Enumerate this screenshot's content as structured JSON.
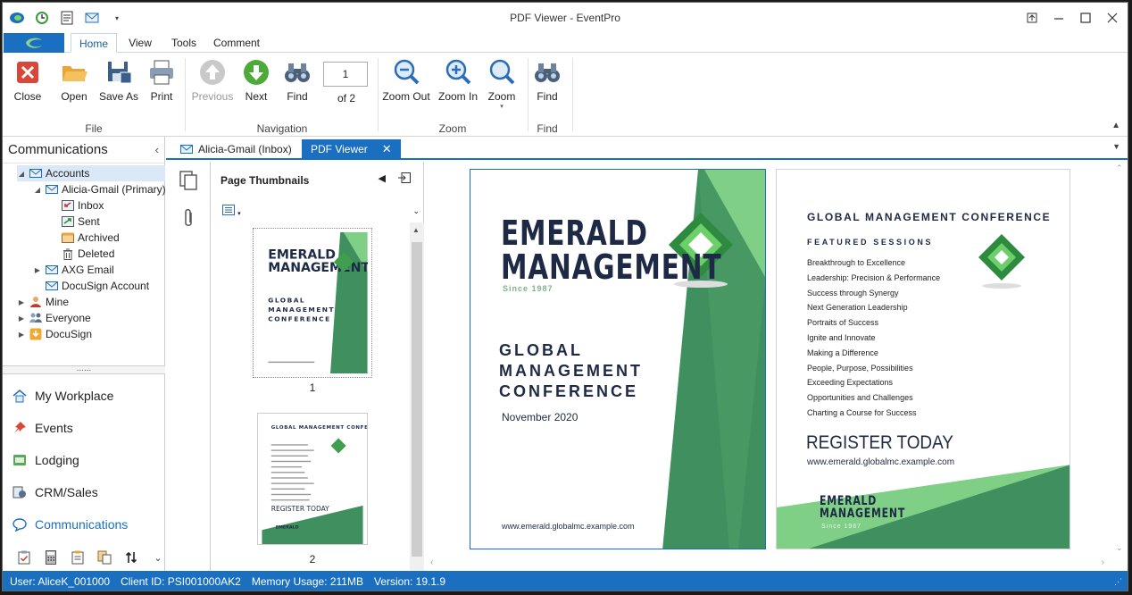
{
  "window": {
    "title": "PDF Viewer - EventPro"
  },
  "ribbon_tabs": [
    "Home",
    "View",
    "Tools",
    "Comment"
  ],
  "ribbon": {
    "file": {
      "label": "File",
      "close": "Close",
      "open": "Open",
      "save_as": "Save As",
      "print": "Print"
    },
    "navigation": {
      "label": "Navigation",
      "previous": "Previous",
      "next": "Next",
      "find": "Find",
      "page_value": "1",
      "of_pages": "of 2"
    },
    "zoom": {
      "label": "Zoom",
      "zoom_out": "Zoom Out",
      "zoom_in": "Zoom In",
      "zoom": "Zoom"
    },
    "find": {
      "label": "Find",
      "find": "Find"
    }
  },
  "leftnav": {
    "title": "Communications",
    "tree": {
      "accounts": "Accounts",
      "alicia": "Alicia-Gmail (Primary)",
      "inbox": "Inbox",
      "sent": "Sent",
      "archived": "Archived",
      "deleted": "Deleted",
      "axg": "AXG Email",
      "docusign_account": "DocuSign Account",
      "mine": "Mine",
      "everyone": "Everyone",
      "docusign": "DocuSign"
    },
    "nav": {
      "workplace": "My Workplace",
      "events": "Events",
      "lodging": "Lodging",
      "crm": "CRM/Sales",
      "communications": "Communications"
    }
  },
  "doc_tabs": {
    "inbox_tab": "Alicia-Gmail (Inbox)",
    "pdf_tab": "PDF Viewer"
  },
  "thumbnails": {
    "title": "Page Thumbnails",
    "page1": "1",
    "page2": "2"
  },
  "pdf": {
    "page1": {
      "brand_line1": "EMERALD",
      "brand_line2": "MANAGEMENT",
      "since": "Since 1987",
      "conf1": "GLOBAL",
      "conf2": "MANAGEMENT",
      "conf3": "CONFERENCE",
      "date": "November 2020",
      "url": "www.emerald.globalmc.example.com"
    },
    "page2": {
      "heading": "GLOBAL MANAGEMENT CONFERENCE",
      "featured": "FEATURED SESSIONS",
      "sessions": [
        "Breakthrough to Excellence",
        "Leadership: Precision & Performance",
        "Success through Synergy",
        "Next Generation Leadership",
        "Portraits of Success",
        "Ignite and Innovate",
        "Making a Difference",
        "People, Purpose, Possibilities",
        "Exceeding Expectations",
        "Opportunities and Challenges",
        "Charting a Course for Success"
      ],
      "register": "REGISTER TODAY",
      "url": "www.emerald.globalmc.example.com",
      "brand_line1": "EMERALD",
      "brand_line2": "MANAGEMENT",
      "since": "Since 1987"
    }
  },
  "status": {
    "user": "User: AliceK_001000",
    "client": "Client ID: PSI001000AK2",
    "memory": "Memory Usage: 211MB",
    "version": "Version: 19.1.9"
  },
  "colors": {
    "accent": "#1a6fc0",
    "green_dark": "#3f8f5f",
    "green_light": "#7fcf86",
    "navy": "#1e2a45"
  }
}
